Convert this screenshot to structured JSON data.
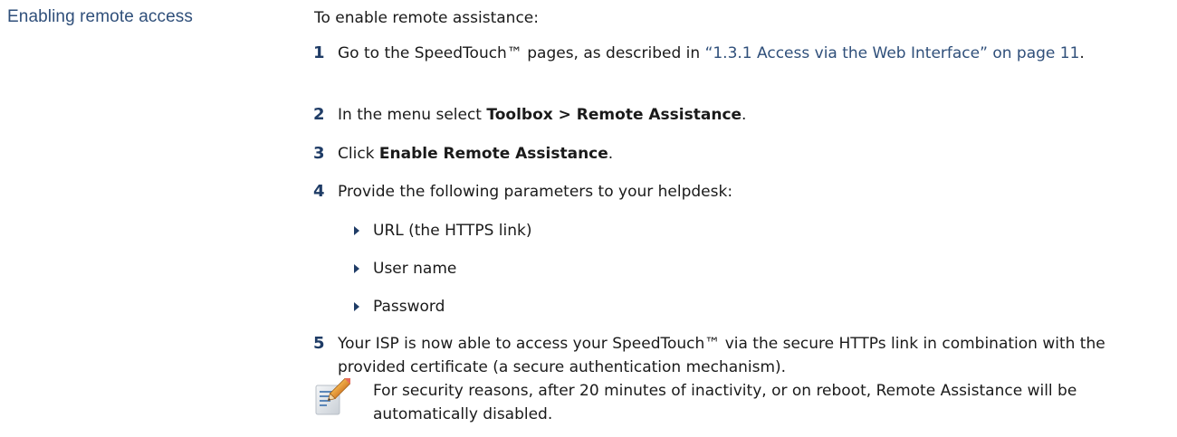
{
  "section": {
    "heading": "Enabling remote access",
    "intro": "To enable remote assistance:"
  },
  "steps": [
    {
      "num": "1",
      "pre": "Go to the SpeedTouch™ pages, as described in ",
      "link": "“1.3.1 Access via the Web Interface” on page 11",
      "post": "."
    },
    {
      "num": "2",
      "pre": "In the menu select ",
      "bold": "Toolbox > Remote Assistance",
      "post": "."
    },
    {
      "num": "3",
      "pre": "Click ",
      "bold": "Enable Remote Assistance",
      "post": "."
    },
    {
      "num": "4",
      "text": "Provide the following parameters to your helpdesk:"
    },
    {
      "num": "5",
      "text": "Your ISP is now able to access your SpeedTouch™ via the secure HTTPs link in combination with the provided certificate (a secure authentication mechanism)."
    }
  ],
  "parameters": [
    "URL (the HTTPS link)",
    "User name",
    "Password"
  ],
  "note": {
    "icon": "note-pencil-icon",
    "text": "For security reasons, after 20 minutes of inactivity, or on reboot, Remote Assistance will be automatically disabled."
  }
}
